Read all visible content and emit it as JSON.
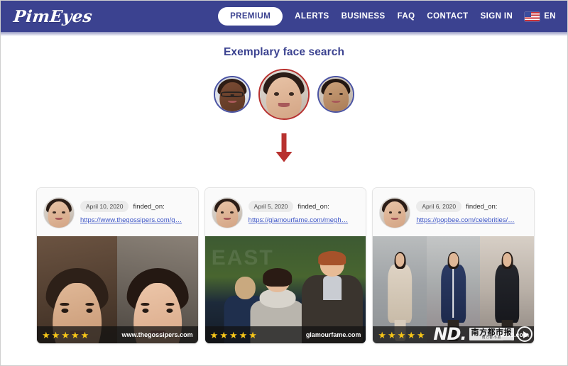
{
  "navbar": {
    "logo": "PimEyes",
    "premium": "PREMIUM",
    "links": [
      {
        "label": "ALERTS"
      },
      {
        "label": "BUSINESS"
      },
      {
        "label": "FAQ"
      },
      {
        "label": "CONTACT"
      },
      {
        "label": "SIGN IN"
      }
    ],
    "language": "EN",
    "flag_icon": "us-flag-icon",
    "background_color": "#3b4290"
  },
  "main": {
    "heading": "Exemplary face search",
    "heading_color": "#3b4290",
    "arrow_icon": "arrow-down-icon",
    "arrow_color": "#b8312f",
    "faces": [
      {
        "name": "face-thumb-1",
        "selected": false,
        "border_color": "#4a53a3"
      },
      {
        "name": "face-thumb-2",
        "selected": true,
        "border_color": "#b8312f"
      },
      {
        "name": "face-thumb-3",
        "selected": false,
        "border_color": "#4a53a3"
      }
    ],
    "results": [
      {
        "date": "April 10, 2020",
        "found_label": "finded_on:",
        "url": "https://www.thegossipers.com/g…",
        "site": "www.thegossipers.com",
        "rating": 5,
        "watermark": null
      },
      {
        "date": "April 5, 2020",
        "found_label": "finded_on:",
        "url": "https://glamourfame.com/megh…",
        "site": "glamourfame.com",
        "rating": 5,
        "watermark": null
      },
      {
        "date": "April 6, 2020",
        "found_label": "finded_on:",
        "url": "https://popbee.com/celebrities/…",
        "site": "popbee.com",
        "rating": 5,
        "watermark": {
          "logo": "ND.",
          "cn_title": "南方都市报",
          "cn_sub": "南方都市报",
          "play_icon": "play-icon"
        }
      }
    ],
    "star_glyph": "★",
    "star_color": "#f5c518"
  }
}
